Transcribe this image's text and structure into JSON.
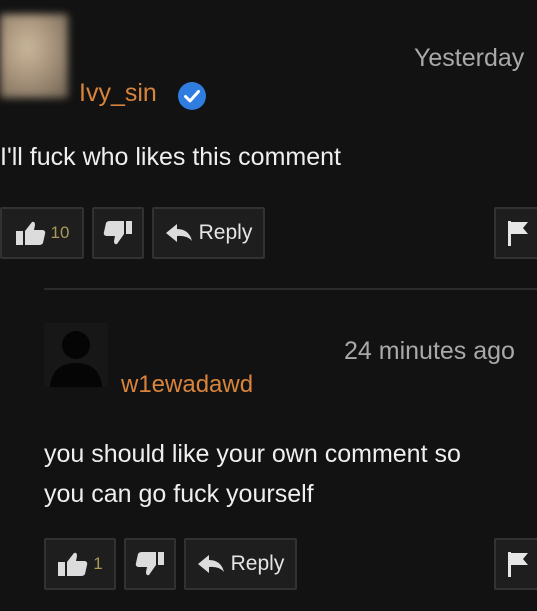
{
  "main_comment": {
    "username": "Ivy_sin",
    "verified_icon": "verified-check-icon",
    "timestamp": "Yesterday",
    "body": "I'll fuck who likes this comment",
    "like_count": "10",
    "reply_label": "Reply",
    "icons": {
      "like": "thumbs-up-icon",
      "dislike": "thumbs-down-icon",
      "reply": "reply-arrow-icon",
      "flag": "flag-icon"
    }
  },
  "reply_comment": {
    "username": "w1ewadawd",
    "timestamp": "24 minutes ago",
    "body_line1": "you should like your own comment so",
    "body_line2": "you can go fuck yourself",
    "like_count": "1",
    "reply_label": "Reply",
    "icons": {
      "avatar": "default-avatar-icon",
      "like": "thumbs-up-icon",
      "dislike": "thumbs-down-icon",
      "reply": "reply-arrow-icon",
      "flag": "flag-icon"
    }
  },
  "colors": {
    "background": "#121212",
    "username": "#d9843b",
    "like_count": "#a89a55",
    "verified_badge": "#2f7de1",
    "button_bg": "#1e1e1e",
    "button_border": "#323232"
  }
}
